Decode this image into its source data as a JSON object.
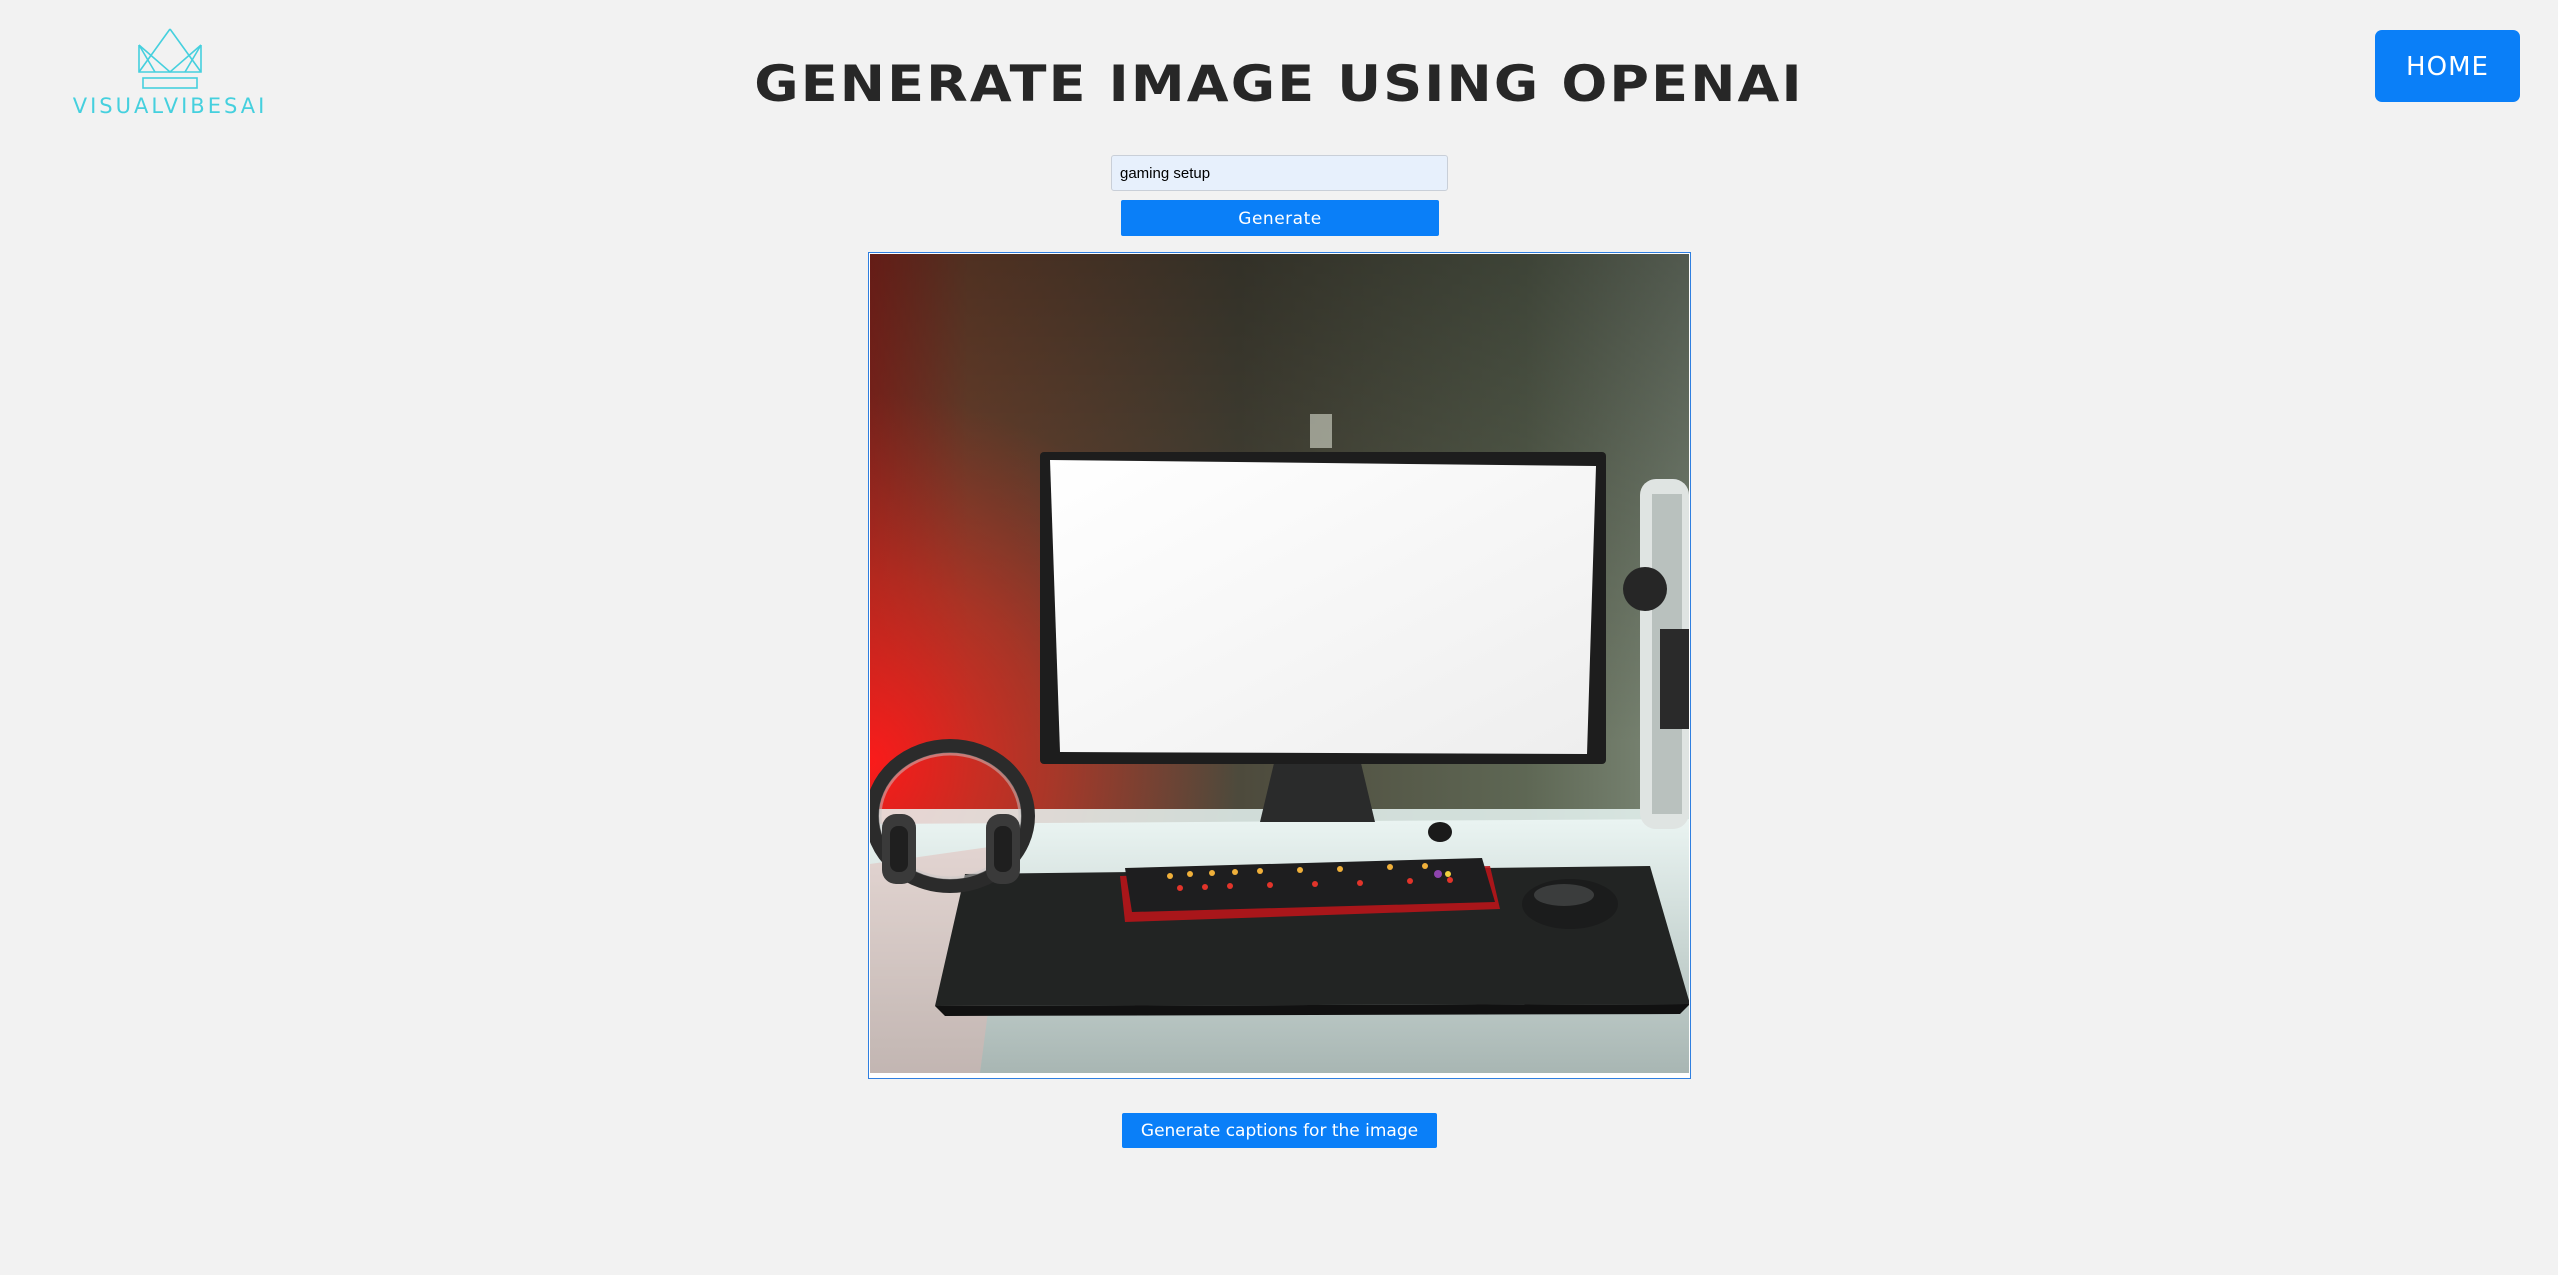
{
  "logo": {
    "text": "VISUALVIBESAI",
    "icon": "crown-icon",
    "color": "#45d0de"
  },
  "header": {
    "title": "GENERATE IMAGE USING OPENAI"
  },
  "nav": {
    "home_label": "HOME"
  },
  "prompt": {
    "value": "gaming setup"
  },
  "actions": {
    "generate_label": "Generate",
    "captions_label": "Generate captions for the image"
  },
  "image": {
    "alt": ""
  },
  "colors": {
    "accent": "#0a7ff8",
    "background": "#f2f2f2",
    "title": "#272727"
  }
}
